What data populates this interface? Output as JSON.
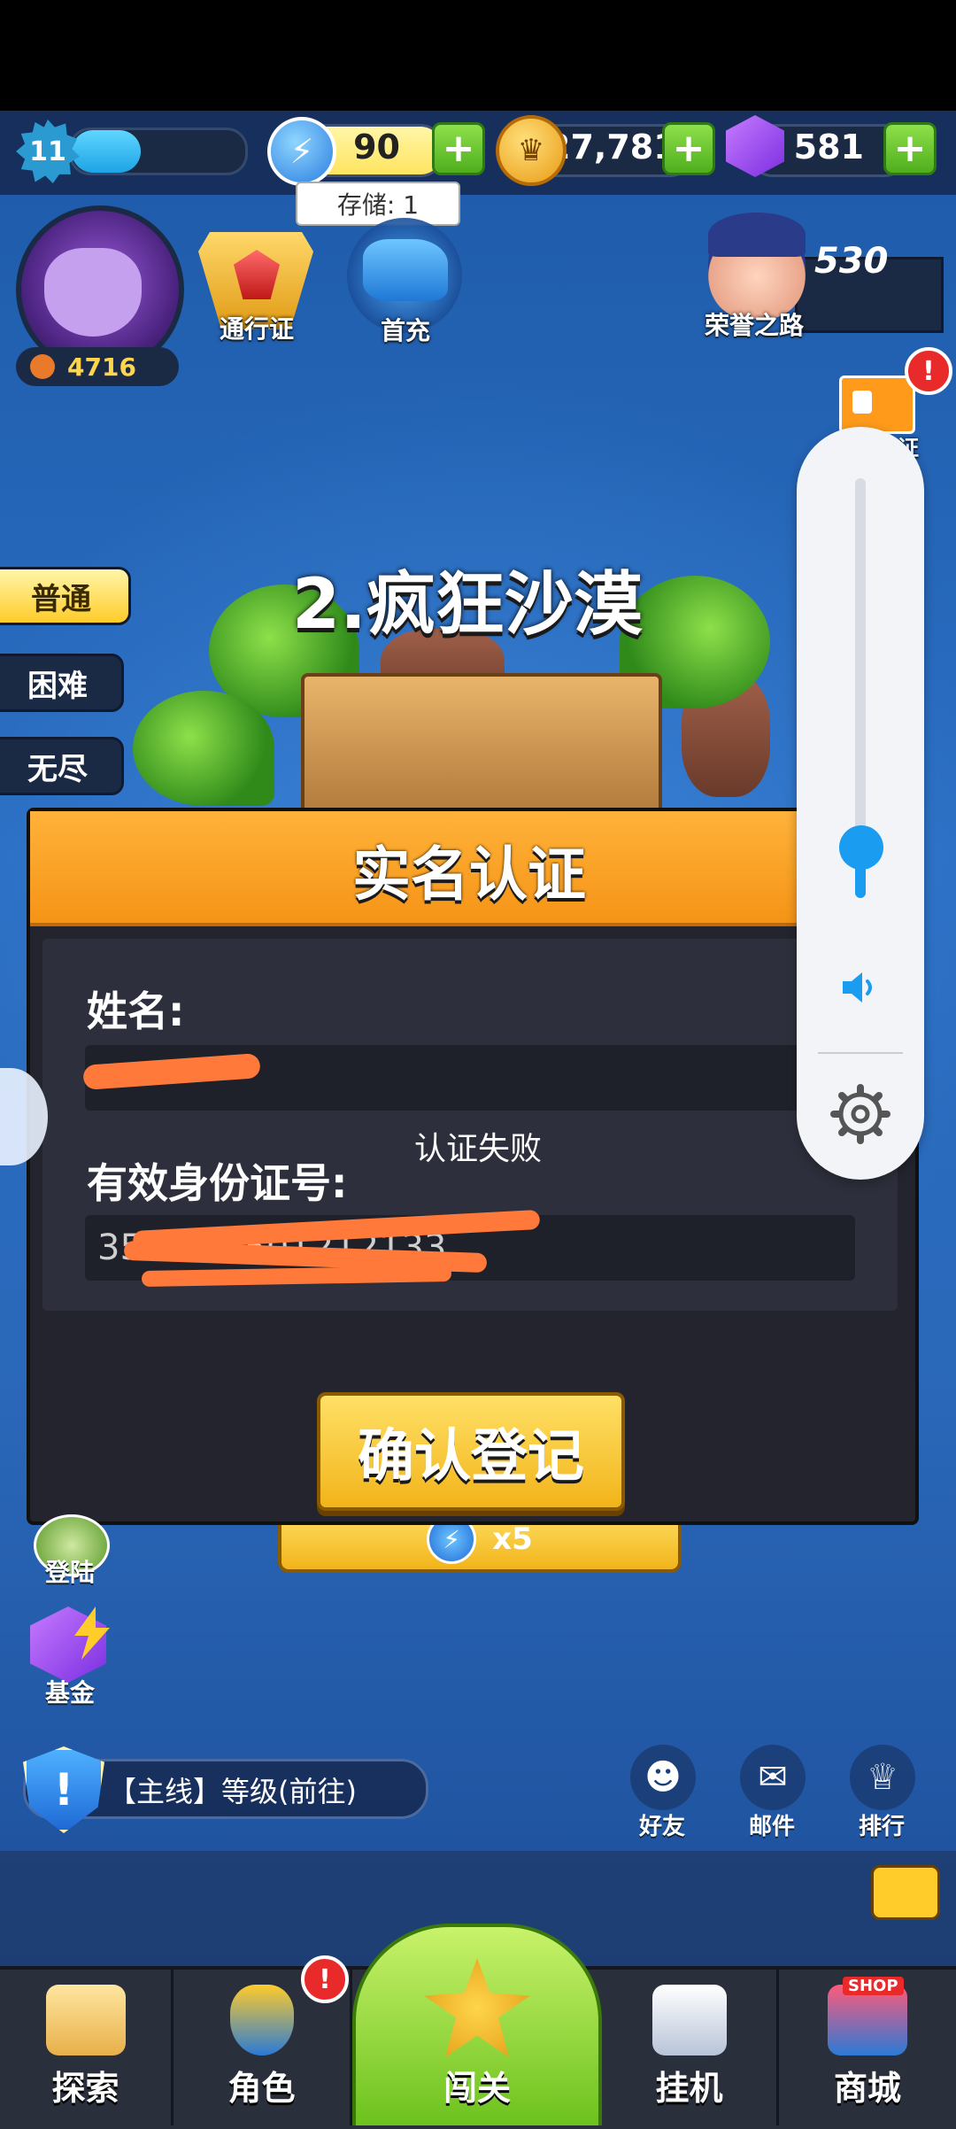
{
  "top_bar": {
    "level": "11",
    "xp_fraction": 0.4,
    "energy": "90",
    "coins": "27,781",
    "gems": "581",
    "plus": "+",
    "energy_tooltip": "存储: 1"
  },
  "header_icons": {
    "power": "4716",
    "pass_label": "通行证",
    "first_pay_label": "首充",
    "honor_value": "530",
    "honor_label": "荣誉之路",
    "realname_label": "实名认证",
    "alert": "!"
  },
  "difficulty_tabs": [
    "普通",
    "困难",
    "无尽"
  ],
  "stage_title": "2.疯狂沙漠",
  "dialog": {
    "title": "实名认证",
    "name_label": "姓名:",
    "name_value": "",
    "id_label": "有效身份证号:",
    "id_value": "350     198501212133",
    "toast": "认证失败",
    "confirm": "确认登记"
  },
  "start_button": {
    "cost": "x5"
  },
  "side_icons": {
    "login": "登陆",
    "fund": "基金"
  },
  "quest": {
    "icon": "!",
    "text": "【主线】等级(前往)"
  },
  "social": {
    "friends": "好友",
    "mail": "邮件",
    "rank": "排行"
  },
  "bottom_nav": {
    "explore": "探索",
    "character": "角色",
    "stage": "闯关",
    "idle": "挂机",
    "shop": "商城",
    "shop_tag": "SHOP"
  },
  "colors": {
    "accent_orange": "#f59416",
    "accent_yellow": "#ffcc2a",
    "accent_green": "#6cc21e",
    "volume_blue": "#1a9cf0",
    "redaction": "#ff7a3a"
  },
  "volume": {
    "level": 0.12
  }
}
